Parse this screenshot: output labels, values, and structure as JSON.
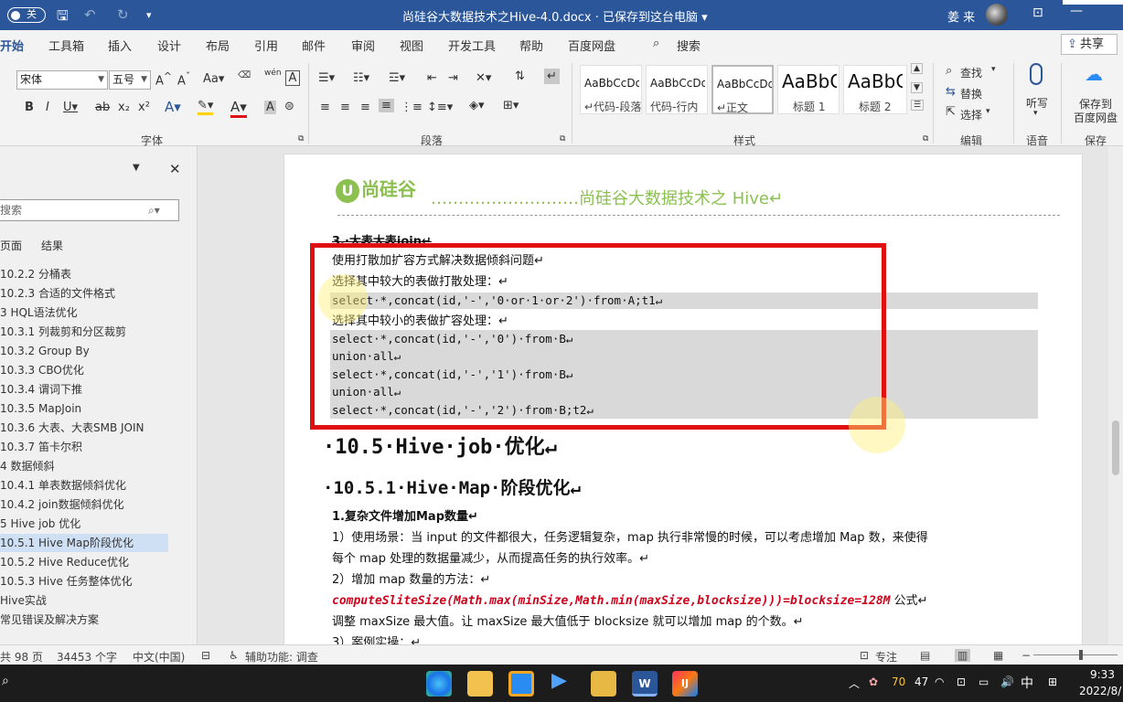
{
  "titlebar": {
    "autosave": "关",
    "title": "尚硅谷大数据技术之Hive-4.0.docx · 已保存到这台电脑 ▾",
    "user": "姜 来"
  },
  "menu": {
    "tabs": [
      "开始",
      "工具箱",
      "插入",
      "设计",
      "布局",
      "引用",
      "邮件",
      "审阅",
      "视图",
      "开发工具",
      "帮助",
      "百度网盘",
      "搜索"
    ],
    "share": "共享"
  },
  "ribbon": {
    "font_name": "宋体",
    "font_size": "五号",
    "wen": "wén",
    "styles": [
      {
        "sample": "AaBbCcDdE",
        "name": "↵代码-段落"
      },
      {
        "sample": "AaBbCcDdE",
        "name": "代码-行内"
      },
      {
        "sample": "AaBbCcDd",
        "name": "↵正文"
      },
      {
        "sample": "AaBbC",
        "name": "标题 1"
      },
      {
        "sample": "AaBbC",
        "name": "标题 2"
      }
    ],
    "find": "查找",
    "replace": "替换",
    "select": "选择",
    "listen": "听写",
    "save_baidu": "保存到",
    "save_baidu2": "百度网盘",
    "groups": {
      "font": "字体",
      "paragraph": "段落",
      "styles": "样式",
      "editing": "编辑",
      "voice": "语音",
      "save": "保存"
    }
  },
  "nav": {
    "search_placeholder": "搜索",
    "tabs": [
      "页面",
      "结果"
    ],
    "items": [
      "10.2.2 分桶表",
      "10.2.3 合适的文件格式",
      "3 HQL语法优化",
      "10.3.1 列裁剪和分区裁剪",
      "10.3.2 Group By",
      "10.3.3 CBO优化",
      "10.3.4 谓词下推",
      "10.3.5 MapJoin",
      "10.3.6 大表、大表SMB JOIN",
      "10.3.7 笛卡尔积",
      "4 数据倾斜",
      "10.4.1 单表数据倾斜优化",
      "10.4.2 join数据倾斜优化",
      "5 Hive job 优化",
      "10.5.1 Hive Map阶段优化",
      "10.5.2 Hive Reduce优化",
      "10.5.3 Hive 任务整体优化",
      "Hive实战",
      "常见错误及解决方案"
    ],
    "selected_index": 14
  },
  "doc": {
    "header_logo": "尚硅谷",
    "header_text": "………………………尚硅谷大数据技术之 Hive↵",
    "section3": "3.·大表大表join↵",
    "lines": [
      "使用打散加扩容方式解决数据倾斜问题↵",
      "选择其中较大的表做打散处理：↵",
      "select·*,concat(id,'-','0·or·1·or·2')·from·A;t1↵",
      "选择其中较小的表做扩容处理：↵",
      "select·*,concat(id,'-','0')·from·B↵",
      "union·all↵",
      "select·*,concat(id,'-','1')·from·B↵",
      "union·all↵",
      "select·*,concat(id,'-','2')·from·B;t2↵"
    ],
    "h2": "·10.5·Hive·job·优化↵",
    "h3": "·10.5.1·Hive·Map·阶段优化↵",
    "sub1": "1.复杂文件增加Map数量↵",
    "p1a": "1）使用场景：当 input 的文件都很大，任务逻辑复杂，map 执行非常慢的时候，可以考虑增加 Map 数，来使得",
    "p1b": "每个 map 处理的数据量减少，从而提高任务的执行效率。↵",
    "p2": "2）增加 map 数量的方法：↵",
    "formula": "computeSliteSize(Math.max(minSize,Math.min(maxSize,blocksize)))=blocksize=128M",
    "formula_suffix": "公式↵",
    "p3": "调整 maxSize 最大值。让 maxSize 最大值低于 blocksize 就可以增加 map 的个数。↵",
    "p4": "3）案例实操：↵"
  },
  "status": {
    "pages": "共 98 页",
    "words": "34453 个字",
    "lang": "中文(中国)",
    "accessibility": "辅助功能: 调查",
    "focus": "专注"
  },
  "taskbar": {
    "temp": "70",
    "num": "47",
    "ime": "中",
    "time": "9:33",
    "date": "2022/8/"
  },
  "colors": {
    "brand": "#2b579a",
    "redbox": "#e01010",
    "logo": "#8cc152",
    "formula": "#d0021b"
  }
}
